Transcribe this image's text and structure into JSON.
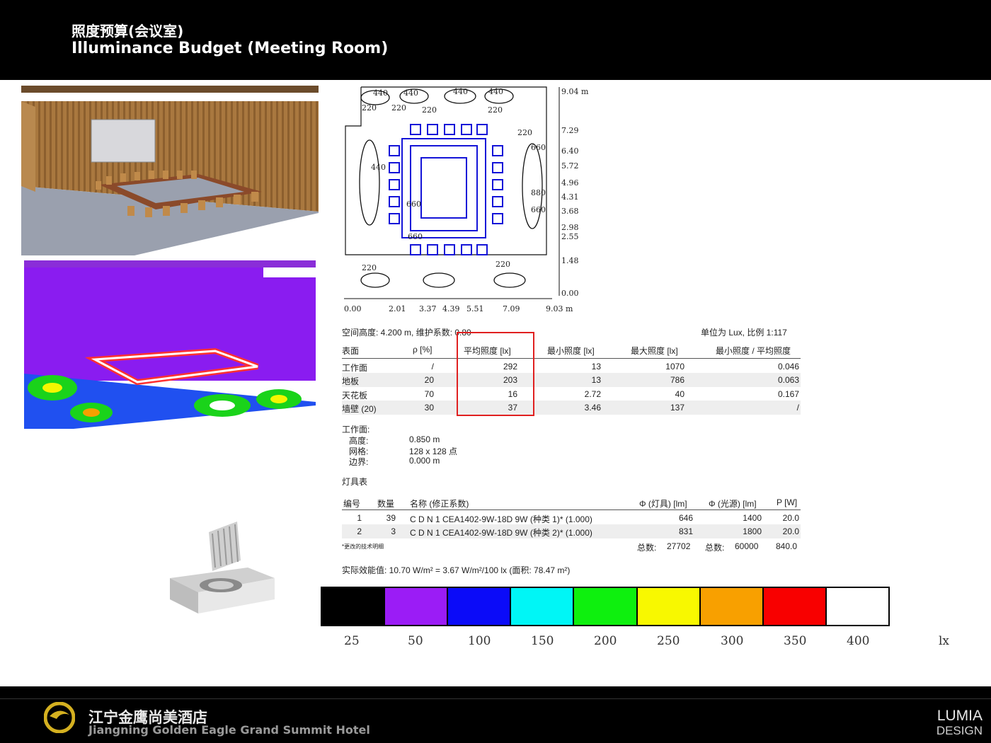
{
  "header": {
    "title_cn": "照度预算(会议室)",
    "title_en": "Illuminance Budget (Meeting Room)"
  },
  "footer": {
    "hotel_cn": "江宁金鹰尚美酒店",
    "hotel_en": "Jiangning Golden Eagle Grand Summit Hotel",
    "brand_line1": "LUMIA",
    "brand_line2": "DESIGN"
  },
  "plan": {
    "y_ticks": [
      "9.04 m",
      "7.29",
      "6.40",
      "5.72",
      "4.96",
      "4.31",
      "3.68",
      "2.98",
      "2.55",
      "1.48",
      "0.00"
    ],
    "x_ticks": [
      "0.00",
      "2.01",
      "3.37",
      "4.39",
      "5.51",
      "7.09",
      "9.03 m"
    ],
    "iso_labels": [
      "440",
      "440",
      "440",
      "440",
      "440",
      "220",
      "220",
      "220",
      "220",
      "220",
      "660",
      "880",
      "660",
      "660",
      "660",
      "220",
      "220"
    ]
  },
  "info": {
    "space": "空间高度: 4.200 m, 维护系数: 0.80",
    "unit": "单位为 Lux, 比例 1:117"
  },
  "surfaces": {
    "headers": [
      "表面",
      "ρ [%]",
      "平均照度 [lx]",
      "最小照度 [lx]",
      "最大照度 [lx]",
      "最小照度 / 平均照度"
    ],
    "rows": [
      [
        "工作面",
        "/",
        "292",
        "13",
        "1070",
        "0.046"
      ],
      [
        "地板",
        "20",
        "203",
        "13",
        "786",
        "0.063"
      ],
      [
        "天花板",
        "70",
        "16",
        "2.72",
        "40",
        "0.167"
      ],
      [
        "墙壁 (20)",
        "30",
        "37",
        "3.46",
        "137",
        "/"
      ]
    ]
  },
  "workplane": {
    "title": "工作面:",
    "labels": [
      "高度:",
      "网格:",
      "边界:"
    ],
    "values": [
      "0.850 m",
      "128 x 128 点",
      "0.000 m"
    ]
  },
  "luminaires": {
    "title": "灯具表",
    "headers": [
      "编号",
      "数量",
      "名称 (修正系数)",
      "Φ (灯具) [lm]",
      "Φ (光源) [lm]",
      "P [W]"
    ],
    "rows": [
      [
        "1",
        "39",
        "C D N 1 CEA1402-9W-18D 9W (种类 1)* (1.000)",
        "646",
        "1400",
        "20.0"
      ],
      [
        "2",
        "3",
        "C D N 1 CEA1402-9W-18D 9W (种类 2)* (1.000)",
        "831",
        "1800",
        "20.0"
      ]
    ],
    "note": "*更改的技术明细",
    "total_label1": "总数:",
    "total_lum": "27702",
    "total_label2": "总数:",
    "total_lamp": "60000",
    "total_power": "840.0"
  },
  "efficiency": "实际效能值: 10.70 W/m² = 3.67 W/m²/100 lx (面积: 78.47 m²)",
  "color_scale": {
    "colors": [
      "#000000",
      "#9b1cf6",
      "#0b0bf8",
      "#00f6f6",
      "#0ef00e",
      "#f8f800",
      "#f8a000",
      "#f80000",
      "#ffffff"
    ],
    "labels": [
      "25",
      "50",
      "100",
      "150",
      "200",
      "250",
      "300",
      "350",
      "400"
    ],
    "unit": "lx"
  }
}
